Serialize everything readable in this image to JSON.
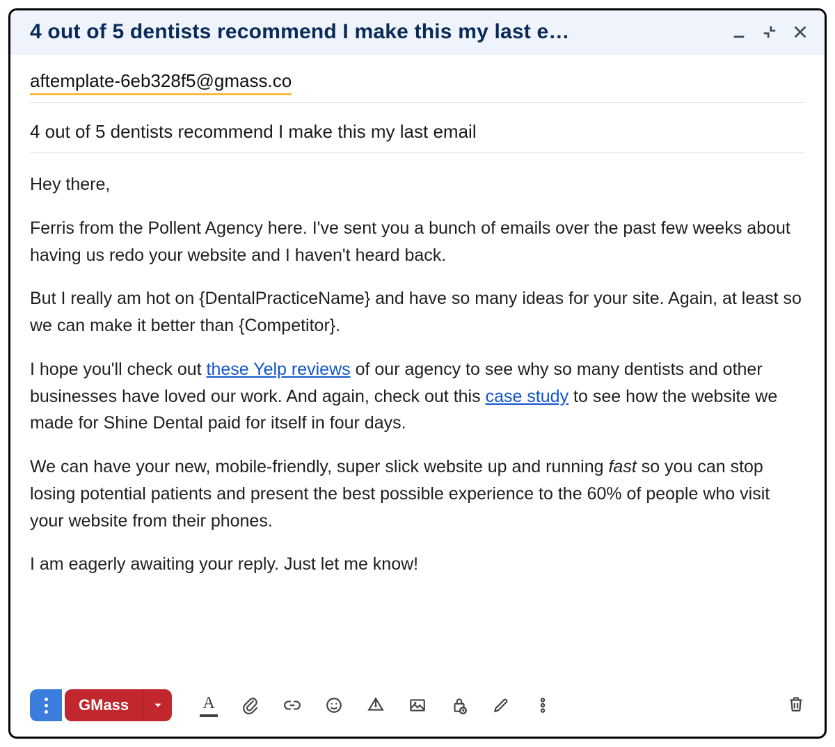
{
  "header": {
    "title_truncated": "4 out of 5 dentists recommend I make this my last e…"
  },
  "compose": {
    "recipient": "aftemplate-6eb328f5@gmass.co",
    "subject": "4 out of 5 dentists recommend I make this my last email",
    "body": {
      "greeting": "Hey there,",
      "p1": "Ferris from the Pollent Agency here. I've sent you a bunch of emails over the past few weeks about having us redo your website and I haven't heard back.",
      "p2": "But I really am hot on {DentalPracticeName} and have so many ideas for your site. Again, at least so we can make it better than {Competitor}.",
      "p3_a": "I hope you'll check out ",
      "p3_link1": "these Yelp reviews",
      "p3_b": " of our agency to see why so many dentists and other businesses have loved our work. And again, check out this ",
      "p3_link2": "case study",
      "p3_c": " to see how the website we made for Shine Dental paid for itself in four days.",
      "p4_a": "We can have your new, mobile-friendly, super slick website up and running ",
      "p4_em": "fast",
      "p4_b": " so you can stop losing potential patients and present the best possible experience to the 60% of people who visit your website from their phones.",
      "p5": "I am eagerly awaiting your reply. Just let me know!"
    }
  },
  "toolbar": {
    "gmass_label": "GMass"
  }
}
